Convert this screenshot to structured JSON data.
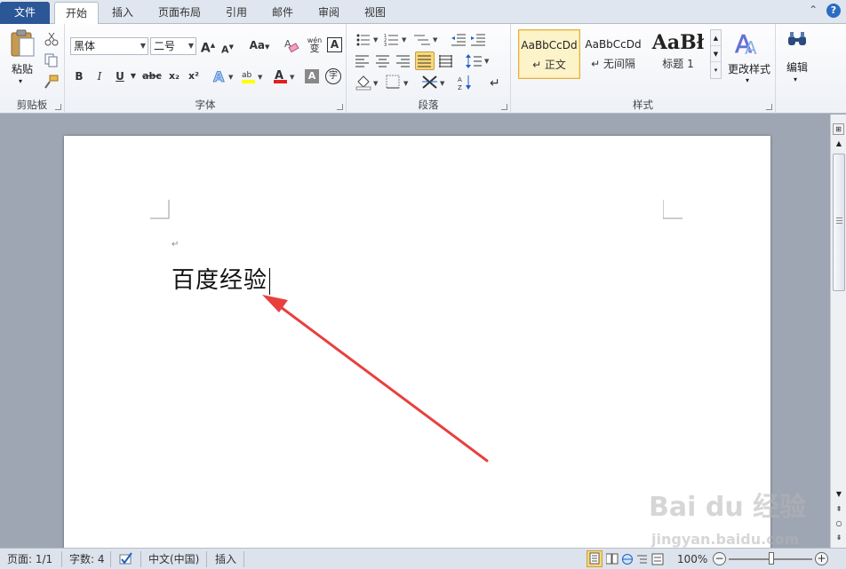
{
  "tabs": [
    {
      "label": "文件",
      "active": false
    },
    {
      "label": "开始",
      "active": true
    },
    {
      "label": "插入",
      "active": false
    },
    {
      "label": "页面布局",
      "active": false
    },
    {
      "label": "引用",
      "active": false
    },
    {
      "label": "邮件",
      "active": false
    },
    {
      "label": "审阅",
      "active": false
    },
    {
      "label": "视图",
      "active": false
    }
  ],
  "top_icons": {
    "minimize_glyph": "⌃",
    "help_label": "?"
  },
  "clipboard": {
    "paste_label": "粘贴",
    "group_label": "剪贴板"
  },
  "font": {
    "font_name": "黑体",
    "font_size": "二号",
    "group_label": "字体",
    "grow_label": "A",
    "shrink_label": "A",
    "case_label": "Aa",
    "bold": "B",
    "italic": "I",
    "underline": "U",
    "strike": "abc",
    "subscript": "x₂",
    "superscript": "x²",
    "phonetic_label": "wén",
    "charborder_label": "A",
    "enclose_label": "字"
  },
  "paragraph": {
    "group_label": "段落"
  },
  "styles": {
    "group_label": "样式",
    "items": [
      {
        "sample": "AaBbCcDd",
        "name": "↵ 正文"
      },
      {
        "sample": "AaBbCcDd",
        "name": "↵ 无间隔"
      },
      {
        "sample": "AaBł",
        "name": "标题 1"
      }
    ],
    "change_label": "更改样式"
  },
  "editing": {
    "label": "编辑"
  },
  "document": {
    "paragraph_mark": "↵",
    "text": "百度经验"
  },
  "status": {
    "page": "页面: 1/1",
    "words": "字数: 4",
    "language": "中文(中国)",
    "mode": "插入",
    "zoom": "100%"
  },
  "watermark": {
    "brand": "Bai du 经验",
    "url": "jingyan.baidu.com"
  },
  "colors": {
    "file_tab": "#2b5797",
    "annotation_arrow": "#e8403f",
    "font_color_bar": "#e02020",
    "highlight_bar": "#ffff00"
  }
}
